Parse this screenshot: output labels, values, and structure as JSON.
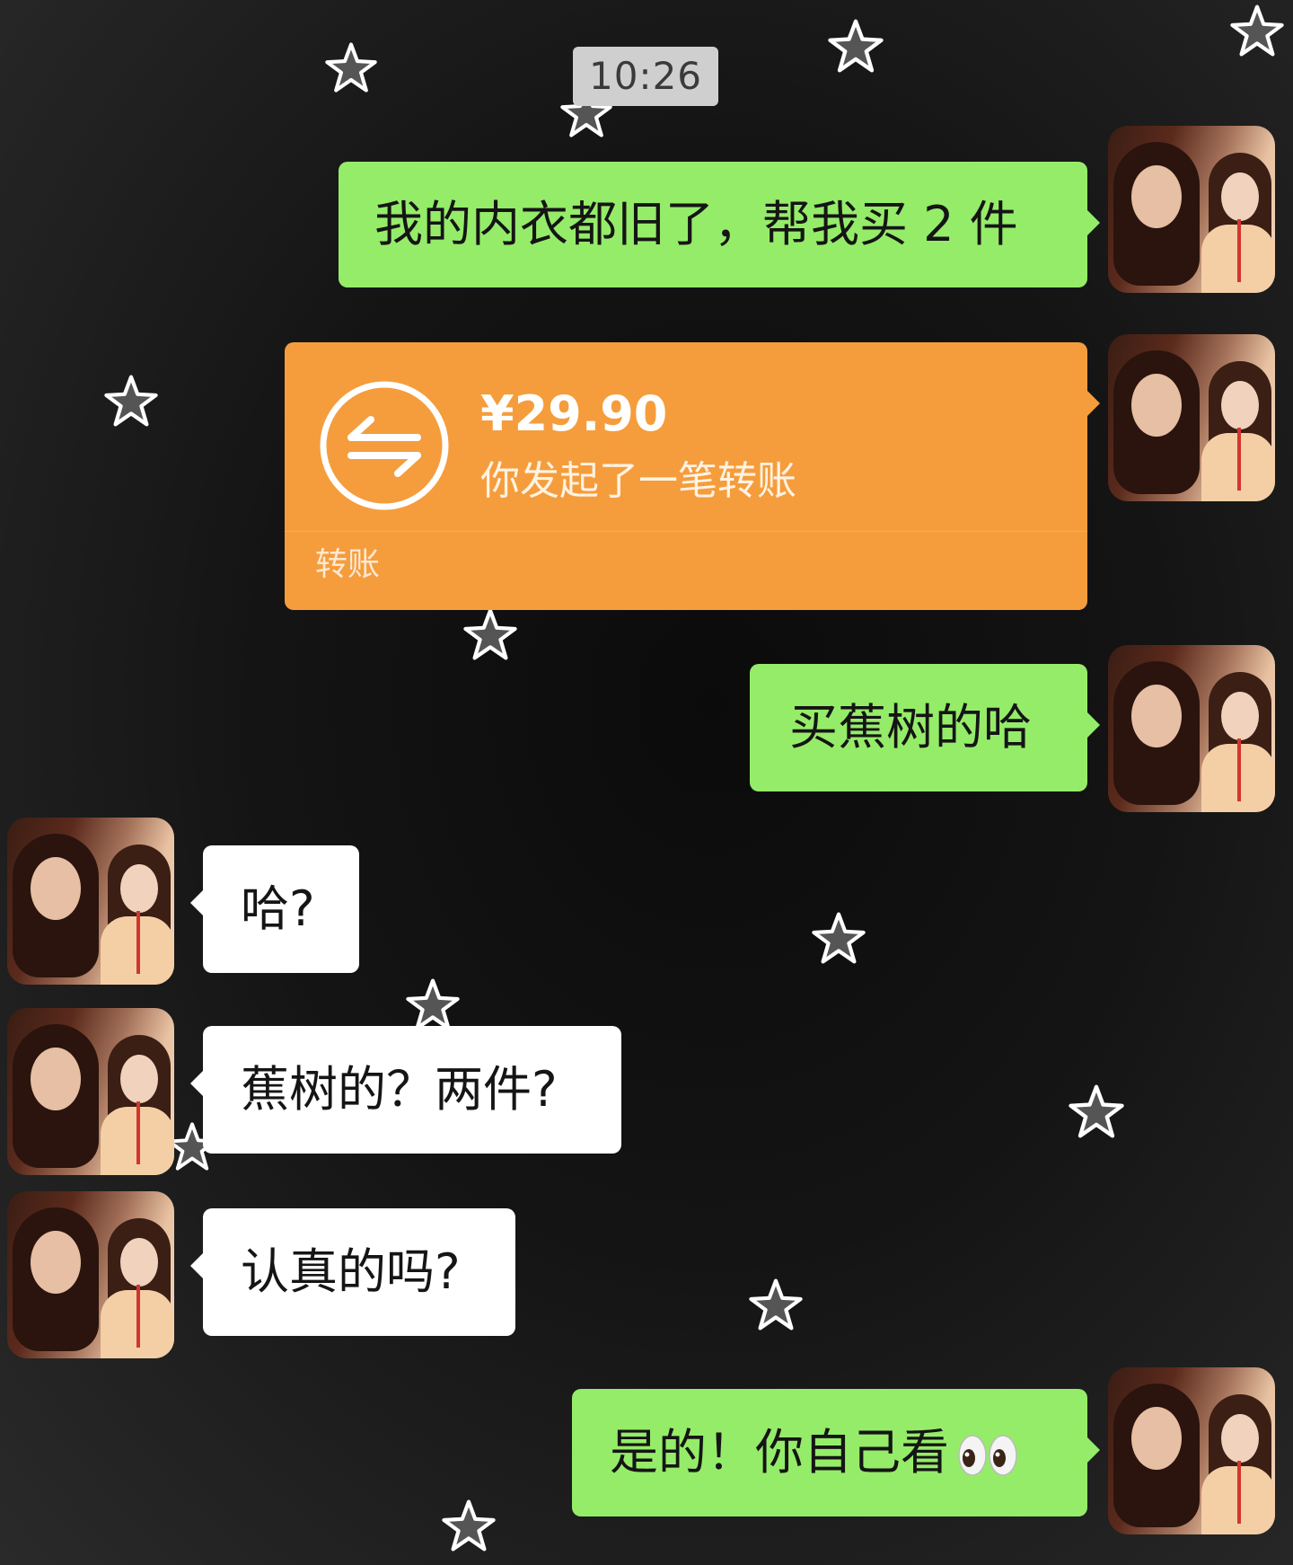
{
  "chat": {
    "timestamp": "10:26",
    "messages": [
      {
        "sender": "self",
        "text": "我的内衣都旧了，帮我买 2 件"
      },
      {
        "sender": "self",
        "type": "transfer",
        "amount": "¥29.90",
        "description": "你发起了一笔转账",
        "footer": "转账"
      },
      {
        "sender": "self",
        "text": "买蕉树的哈"
      },
      {
        "sender": "other",
        "text": "哈?"
      },
      {
        "sender": "other",
        "text": "蕉树的？两件?"
      },
      {
        "sender": "other",
        "text": "认真的吗?"
      },
      {
        "sender": "self",
        "text": "是的！你自己看",
        "emoji": "eyes"
      }
    ]
  },
  "theme": {
    "background": "#111111",
    "self_bubble": "#95ec69",
    "other_bubble": "#ffffff",
    "transfer_card": "#f59d3c",
    "timestamp_pill": "#cfcfcf",
    "decoration": "star-stickers"
  }
}
